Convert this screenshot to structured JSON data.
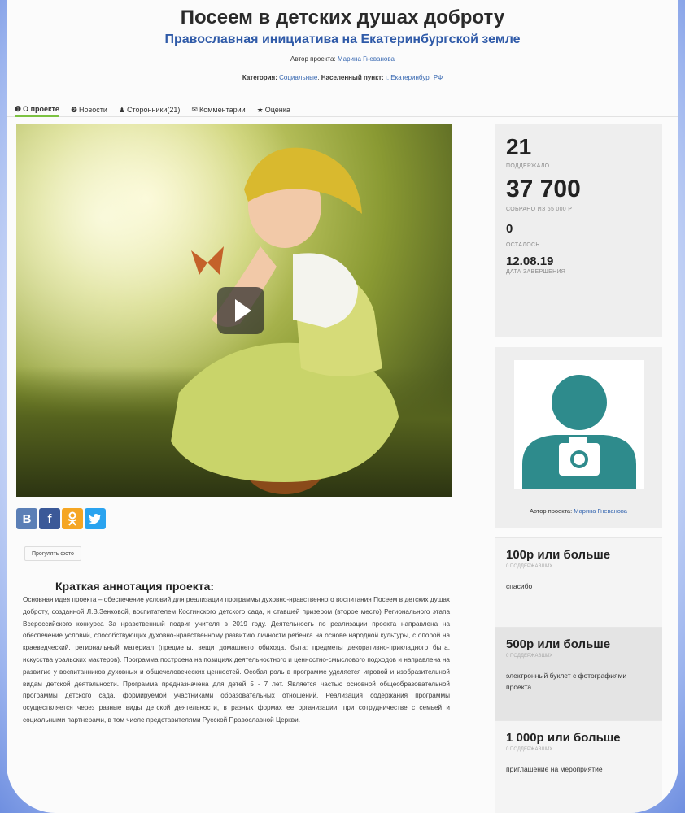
{
  "header": {
    "title": "Посеем в детских душах доброту",
    "subtitle": "Православная инициатива на Екатеринбургской земле",
    "author_label": "Автор проекта:",
    "author_name": "Марина Гневанова",
    "category_label": "Категория:",
    "category_value": "Социальные",
    "location_label": "Населенный пункт:",
    "location_value": "г. Екатеринбург РФ"
  },
  "tabs": [
    {
      "icon": "❶",
      "label": "О проекте",
      "active": true
    },
    {
      "icon": "❷",
      "label": "Новости"
    },
    {
      "icon": "♟",
      "label": "Сторонники(21)"
    },
    {
      "icon": "✉",
      "label": "Комментарии"
    },
    {
      "icon": "★",
      "label": "Оценка"
    }
  ],
  "media": {
    "play_icon": "play-icon",
    "photo_button": "Прогулять фото"
  },
  "social": {
    "vk": "В",
    "fb": "f",
    "ok": "ok",
    "tw": "t"
  },
  "annotation": {
    "title": "Краткая аннотация проекта:",
    "text": "Основная идея проекта – обеспечение условий для реализации программы духовно-нравственного воспитания Посеем в детских душах доброту, созданной Л.В.Зенковой, воспитателем Костинского детского сада, и ставшей призером (второе место) Регионального этапа Всероссийского конкурса За нравственный подвиг учителя в 2019 году. Деятельность по реализации проекта направлена на обеспечение условий, способствующих духовно-нравственному развитию личности ребенка на основе народной культуры, с опорой на краеведческий, региональный материал (предметы, вещи домашнего обихода, быта; предметы декоративно-прикладного быта, искусства уральских мастеров). Программа построена на позициях деятельностного и ценностно-смыслового подходов и направлена на развитие у воспитанников духовных и общечеловеческих ценностей. Особая роль в программе уделяется игровой и изобразительной видам детской деятельности. Программа предназначена для детей 5 - 7 лет. Является частью основной общеобразовательной программы детского сада, формируемой участниками образовательных отношений. Реализация содержания программы осуществляется через разные виды детской деятельности, в разных формах ее организации, при сотрудничестве с семьей и социальными партнерами, в том числе представителями Русской Православной Церкви."
  },
  "stats": {
    "supporters_num": "21",
    "supporters_lbl": "ПОДДЕРЖАЛО",
    "collected_num": "37 700",
    "collected_lbl": "СОБРАНО ИЗ 65 000 Р",
    "left_num": "0",
    "left_lbl": "ОСТАЛОСЬ",
    "end_date": "12.08.19",
    "end_lbl": "ДАТА ЗАВЕРШЕНИЯ"
  },
  "author_box": {
    "caption_label": "Автор проекта:",
    "caption_name": "Марина Гневанова"
  },
  "rewards": [
    {
      "amount": "100р или больше",
      "count": "0 ПОДДЕРЖАВШИХ",
      "desc": "спасибо"
    },
    {
      "amount": "500р или больше",
      "count": "0 ПОДДЕРЖАВШИХ",
      "desc": "электронный буклет с фотографиями проекта"
    },
    {
      "amount": "1 000р или больше",
      "count": "0 ПОДДЕРЖАВШИХ",
      "desc": "приглашение на мероприятие"
    }
  ],
  "colors": {
    "accent_green": "#7cc242",
    "link_blue": "#3566b0",
    "avatar_teal": "#2e8b8c"
  }
}
